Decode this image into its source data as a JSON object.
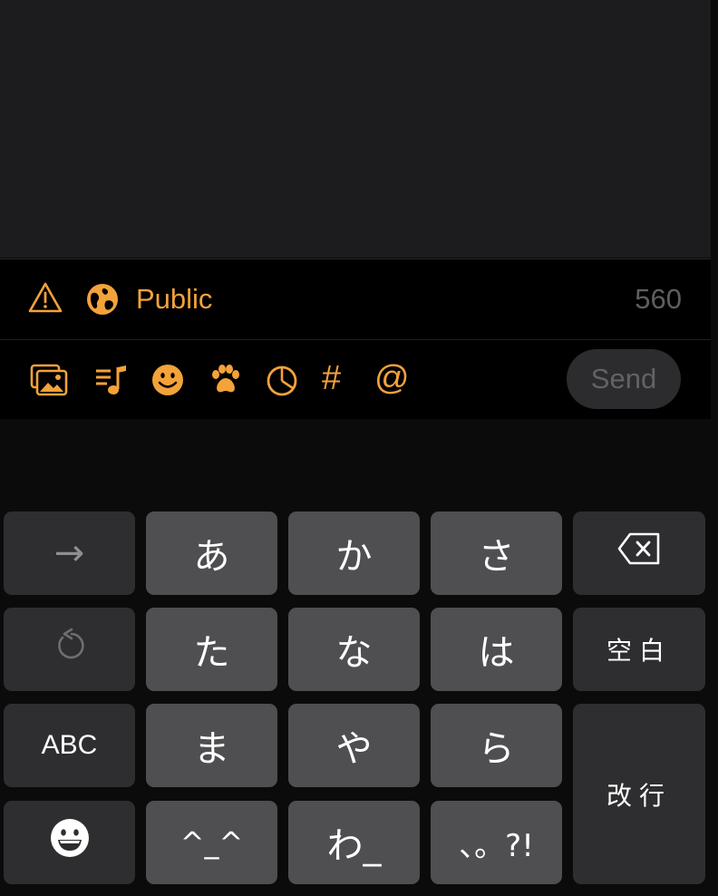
{
  "compose": {
    "visibility_label": "Public",
    "char_count": "560"
  },
  "toolbar": {
    "icons": [
      "photo-library-icon",
      "music-note-icon",
      "emoji-face-icon",
      "paw-icon",
      "poll-icon",
      "hashtag-icon",
      "mention-icon"
    ],
    "hashtag_label": "#",
    "mention_label": "@",
    "send_label": "Send"
  },
  "keyboard": {
    "row1": [
      "→",
      "あ",
      "か",
      "さ"
    ],
    "row2": [
      "た",
      "な",
      "は"
    ],
    "space_label": "空白",
    "abc_label": "ABC",
    "row3": [
      "ま",
      "や",
      "ら"
    ],
    "return_label": "改行",
    "row4": [
      "^_^",
      "わ_",
      "、。?!"
    ]
  },
  "colors": {
    "accent": "#f4a23a",
    "compose_bg": "#1c1c1e",
    "toolbar_bg": "#000000",
    "key_light": "#4f4f51",
    "key_dark": "#2e2e30"
  }
}
